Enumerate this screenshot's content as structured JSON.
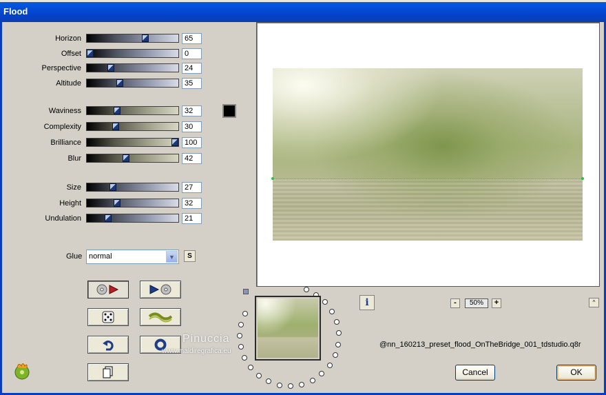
{
  "window": {
    "title": "Flood"
  },
  "params": [
    {
      "label": "Horizon",
      "value": "65",
      "frac": 0.65,
      "track": "blue"
    },
    {
      "label": "Offset",
      "value": "0",
      "frac": 0.0,
      "track": "blue"
    },
    {
      "label": "Perspective",
      "value": "24",
      "frac": 0.24,
      "track": "blue"
    },
    {
      "label": "Altitude",
      "value": "35",
      "frac": 0.35,
      "track": "blue"
    },
    {
      "label": "Waviness",
      "value": "32",
      "frac": 0.32,
      "track": "khaki"
    },
    {
      "label": "Complexity",
      "value": "30",
      "frac": 0.3,
      "track": "khaki"
    },
    {
      "label": "Brilliance",
      "value": "100",
      "frac": 1.0,
      "track": "khaki"
    },
    {
      "label": "Blur",
      "value": "42",
      "frac": 0.42,
      "track": "khaki"
    },
    {
      "label": "Size",
      "value": "27",
      "frac": 0.27,
      "track": "blue"
    },
    {
      "label": "Height",
      "value": "32",
      "frac": 0.32,
      "track": "blue"
    },
    {
      "label": "Undulation",
      "value": "21",
      "frac": 0.21,
      "track": "blue"
    }
  ],
  "color": {
    "swatch": "#000000"
  },
  "glue": {
    "label": "Glue",
    "value": "normal",
    "s_label": "S"
  },
  "toolbar": {
    "buttons": [
      {
        "name": "load-preset-button",
        "icon": "disc-play-icon"
      },
      {
        "name": "save-preset-button",
        "icon": "play-disc-icon"
      },
      {
        "name": "randomize-button",
        "icon": "dice-icon"
      },
      {
        "name": "reset-wave-button",
        "icon": "wave-icon"
      },
      {
        "name": "undo-button",
        "icon": "undo-icon"
      },
      {
        "name": "factory-default-button",
        "icon": "ring-icon"
      },
      {
        "name": "copy-button",
        "icon": "copy-icon"
      }
    ]
  },
  "preview": {
    "zoom": "50%",
    "horizon_color": "#2bbf3a"
  },
  "watermark": {
    "name": "Pinuccia",
    "url": "www.maidiregrafica.eu"
  },
  "preset": {
    "filename": "@nn_160213_preset_flood_OnTheBridge_001_tdstudio.q8r"
  },
  "buttons": {
    "cancel": "Cancel",
    "ok": "OK"
  },
  "info": {
    "label": "i"
  },
  "zoom_controls": {
    "minus": "-",
    "plus": "+",
    "collapse": "^"
  }
}
